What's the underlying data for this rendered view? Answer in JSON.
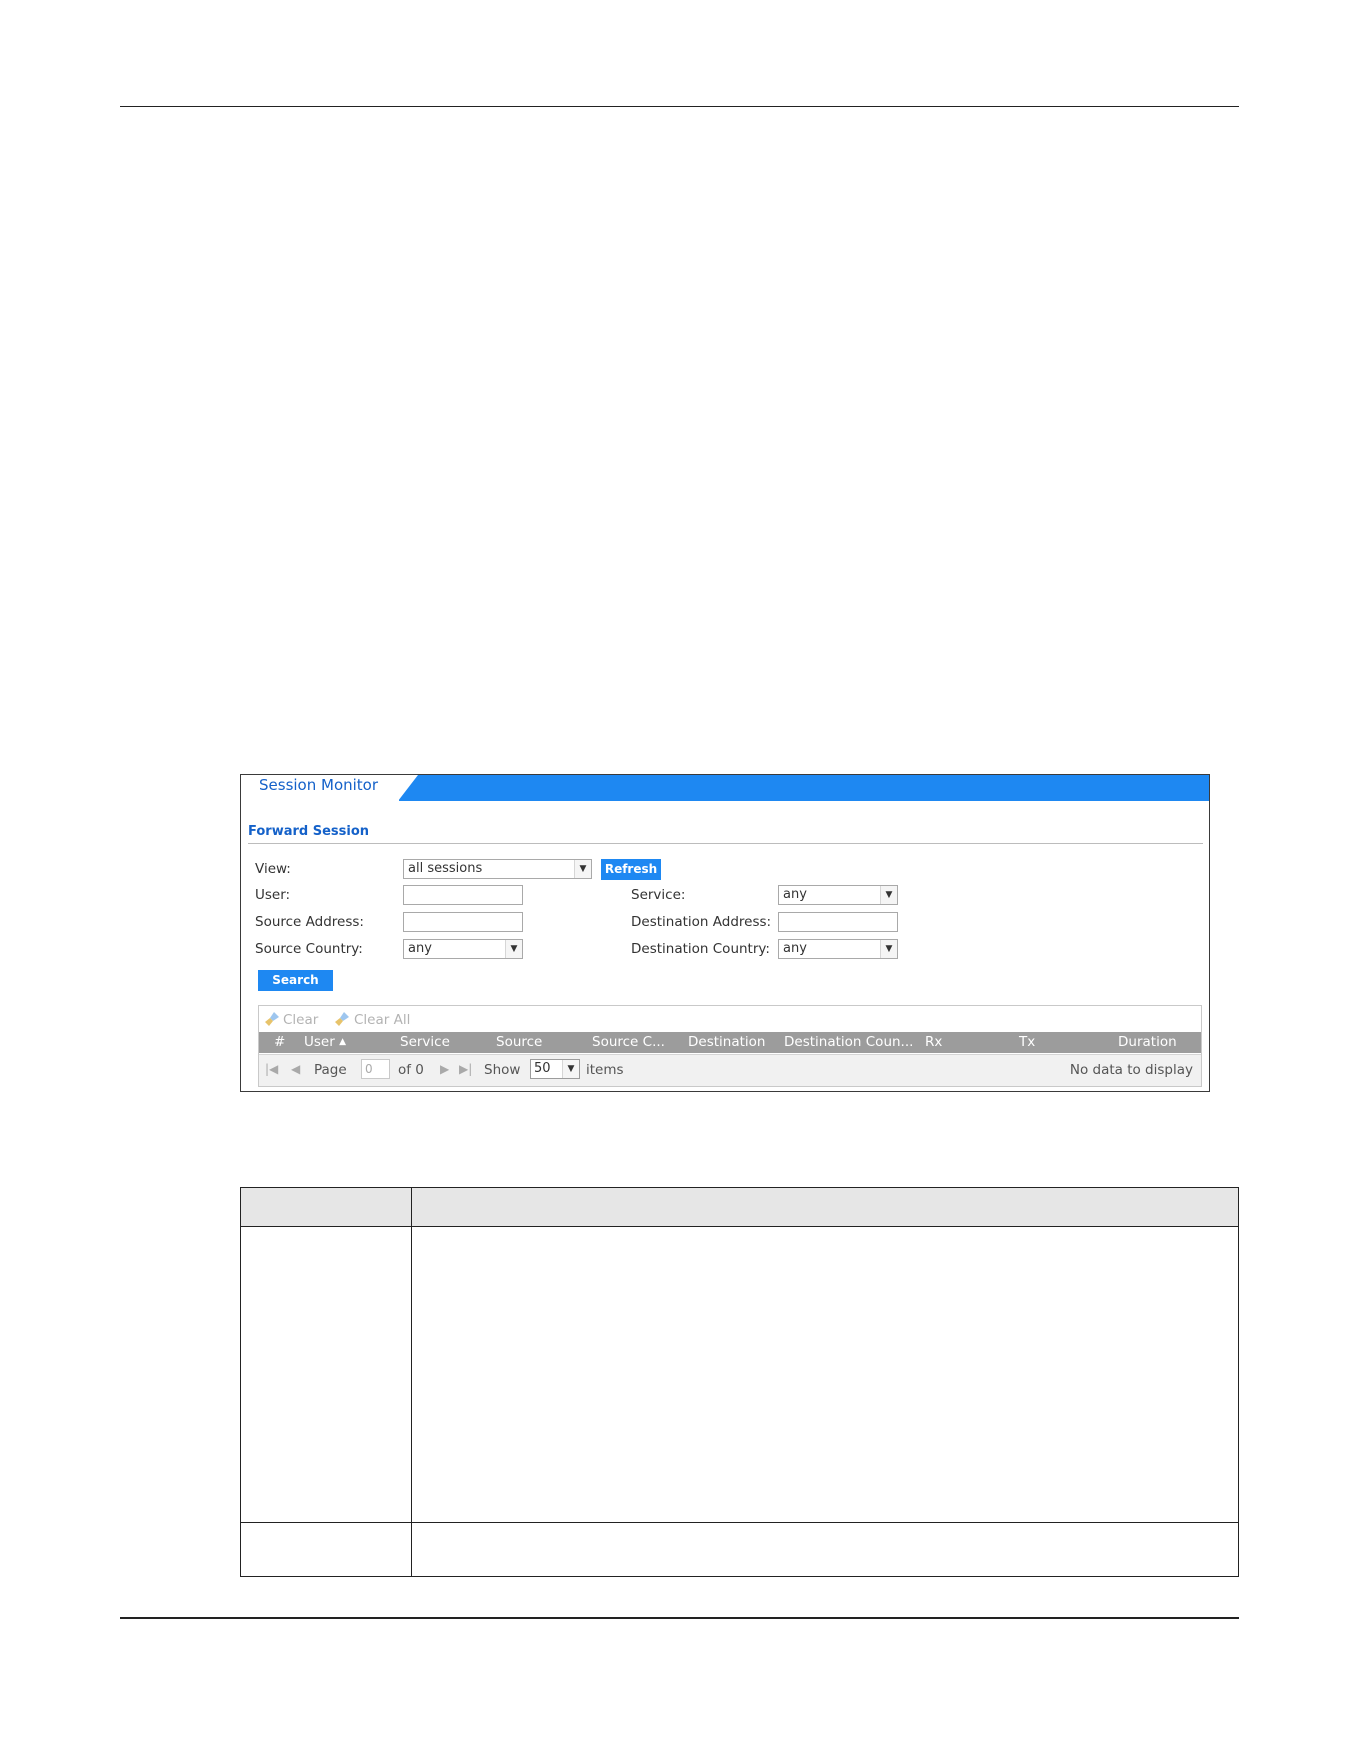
{
  "panel": {
    "title": "Session Monitor",
    "section_title": "Forward Session",
    "form": {
      "view_label": "View:",
      "view_value": "all sessions",
      "refresh_label": "Refresh",
      "user_label": "User:",
      "user_value": "",
      "service_label": "Service:",
      "service_value": "any",
      "source_address_label": "Source Address:",
      "source_address_value": "",
      "destination_address_label": "Destination Address:",
      "destination_address_value": "",
      "source_country_label": "Source Country:",
      "source_country_value": "any",
      "destination_country_label": "Destination Country:",
      "destination_country_value": "any",
      "search_label": "Search"
    },
    "grid": {
      "toolbar": {
        "clear_label": "Clear",
        "clear_all_label": "Clear All"
      },
      "columns": [
        "#",
        "User",
        "Service",
        "Source",
        "Source C...",
        "Destination",
        "Destination Coun...",
        "Rx",
        "Tx",
        "Duration"
      ],
      "sort_indicator": "▲",
      "pager": {
        "page_label": "Page",
        "page_value": "0",
        "of_label": "of 0",
        "show_label": "Show",
        "show_value": "50",
        "items_label": "items",
        "status": "No data to display"
      }
    }
  },
  "colors": {
    "accent_blue": "#1e88f2",
    "title_blue": "#1461c9",
    "header_gray": "#9c9c9c"
  },
  "icons": {
    "clear": "brush-icon",
    "first": "first-page-icon",
    "prev": "prev-page-icon",
    "next": "next-page-icon",
    "last": "last-page-icon",
    "dropdown": "chevron-down-icon"
  }
}
